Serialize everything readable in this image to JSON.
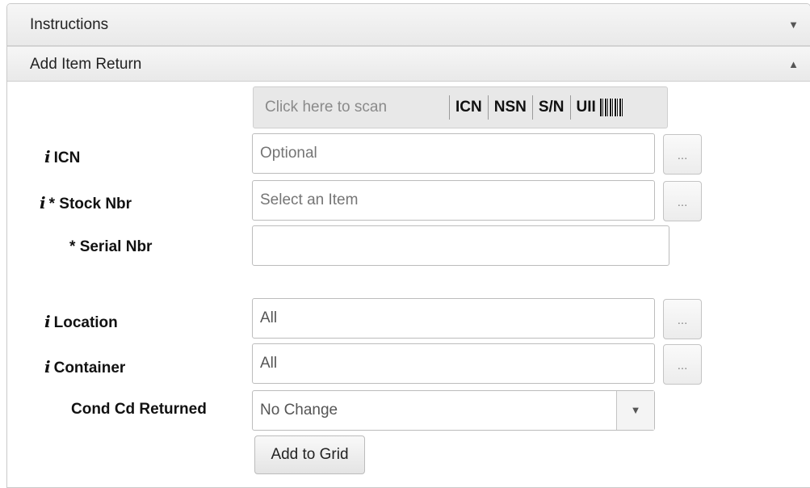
{
  "sections": {
    "instructions": {
      "title": "Instructions",
      "toggle": "▼"
    },
    "add_item_return": {
      "title": "Add Item Return",
      "toggle": "▲"
    }
  },
  "scan": {
    "placeholder": "Click here to scan",
    "codes": [
      "ICN",
      "NSN",
      "S/N",
      "UII"
    ]
  },
  "form": {
    "icn": {
      "info": "i",
      "label": "ICN",
      "placeholder": "Optional",
      "lookup": "..."
    },
    "stock_nbr": {
      "info": "i",
      "required": "*",
      "label": "Stock Nbr",
      "placeholder": "Select an Item",
      "lookup": "..."
    },
    "serial_nbr": {
      "required": "*",
      "label": "Serial Nbr",
      "value": ""
    },
    "location": {
      "info": "i",
      "label": "Location",
      "value": "All",
      "lookup": "..."
    },
    "container": {
      "info": "i",
      "label": "Container",
      "value": "All",
      "lookup": "..."
    },
    "cond_cd_returned": {
      "label": "Cond Cd Returned",
      "value": "No Change",
      "arrow": "▼"
    }
  },
  "actions": {
    "add_to_grid": "Add to Grid"
  }
}
